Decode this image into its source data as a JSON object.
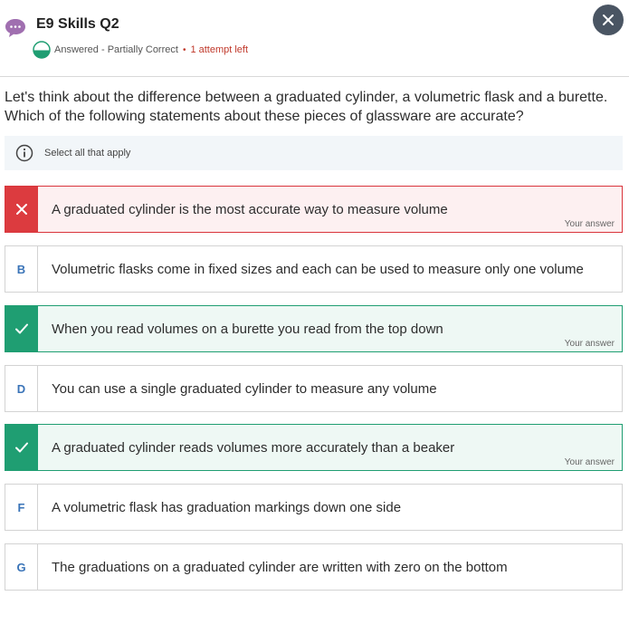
{
  "header": {
    "title": "E9 Skills Q2",
    "status": "Answered - Partially Correct",
    "attempts": "1 attempt left",
    "colors": {
      "close_bg": "#4a5563",
      "chat_icon": "#a06fb0",
      "status_green": "#1f9e72",
      "attempt_red": "#c0392b"
    }
  },
  "question": {
    "text": "Let's think about the difference between a graduated cylinder, a volumetric flask and a burette. Which of the following statements about these pieces of glassware are accurate?"
  },
  "hint": {
    "text": "Select all that apply",
    "icon": "info-icon"
  },
  "your_answer_label": "Your answer",
  "options": [
    {
      "letter": "A",
      "text": "A graduated cylinder is the most accurate way to measure volume",
      "state": "wrong",
      "selected": true
    },
    {
      "letter": "B",
      "text": "Volumetric flasks come in fixed sizes and each can be used to measure only one volume",
      "state": "neutral",
      "selected": false
    },
    {
      "letter": "C",
      "text": "When you read volumes on a burette you read from the top down",
      "state": "correct",
      "selected": true
    },
    {
      "letter": "D",
      "text": "You can use a single graduated cylinder to measure any volume",
      "state": "neutral",
      "selected": false
    },
    {
      "letter": "E",
      "text": "A graduated cylinder reads volumes more accurately than a beaker",
      "state": "correct",
      "selected": true
    },
    {
      "letter": "F",
      "text": "A volumetric flask has graduation markings down one side",
      "state": "neutral",
      "selected": false
    },
    {
      "letter": "G",
      "text": "The graduations on a graduated cylinder are written with zero on the bottom",
      "state": "neutral",
      "selected": false
    }
  ],
  "colors": {
    "wrong": "#dc3b3f",
    "correct": "#1f9e72",
    "letter": "#3a74b8"
  }
}
